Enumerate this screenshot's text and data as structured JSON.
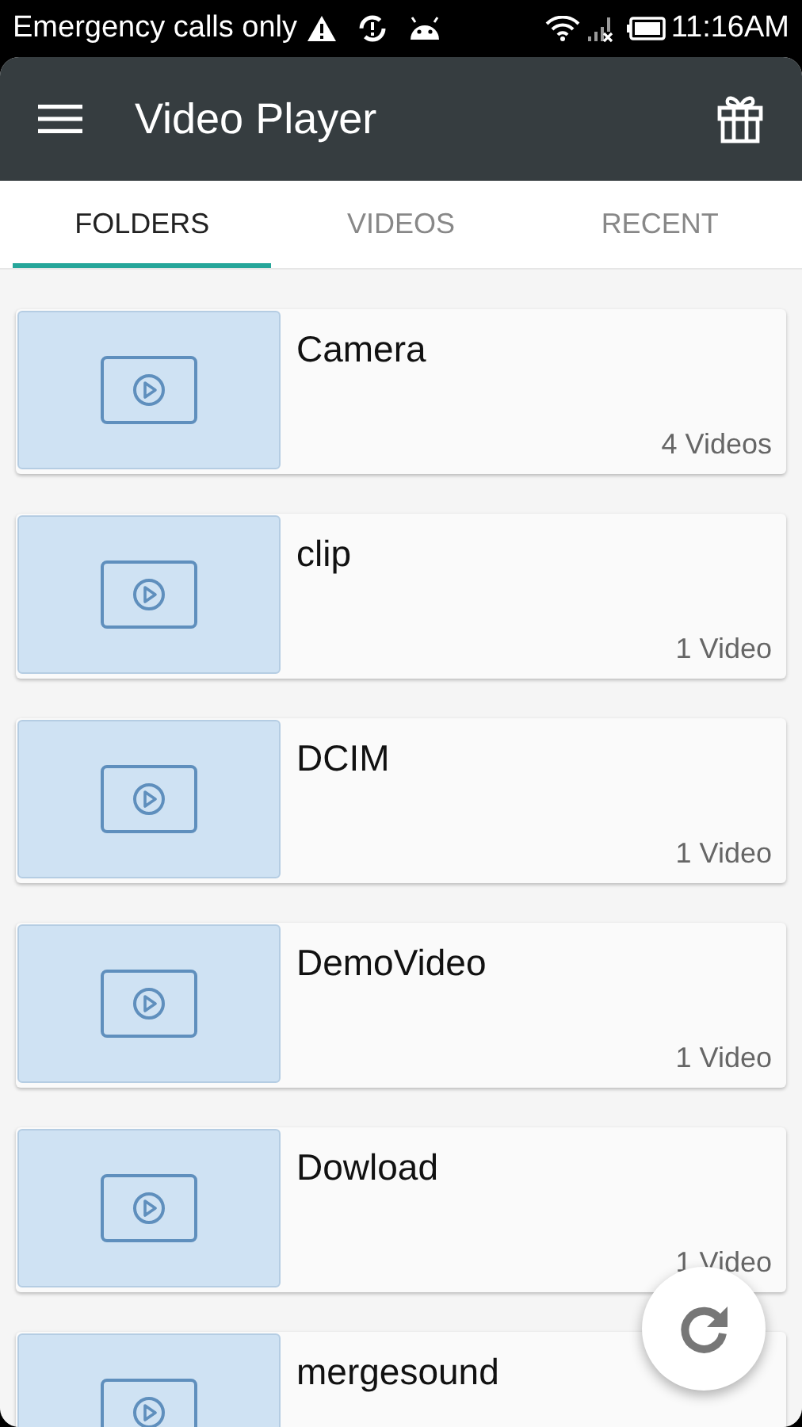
{
  "status_bar": {
    "carrier": "Emergency calls only",
    "time": "11:16AM"
  },
  "app_bar": {
    "title": "Video Player"
  },
  "tabs": [
    {
      "label": "FOLDERS",
      "selected": true
    },
    {
      "label": "VIDEOS",
      "selected": false
    },
    {
      "label": "RECENT",
      "selected": false
    }
  ],
  "folders": [
    {
      "name": "Camera",
      "count": "4 Videos"
    },
    {
      "name": "clip",
      "count": "1 Video"
    },
    {
      "name": "DCIM",
      "count": "1 Video"
    },
    {
      "name": "DemoVideo",
      "count": "1 Video"
    },
    {
      "name": "Dowload",
      "count": "1 Video"
    },
    {
      "name": "mergesound"
    }
  ]
}
